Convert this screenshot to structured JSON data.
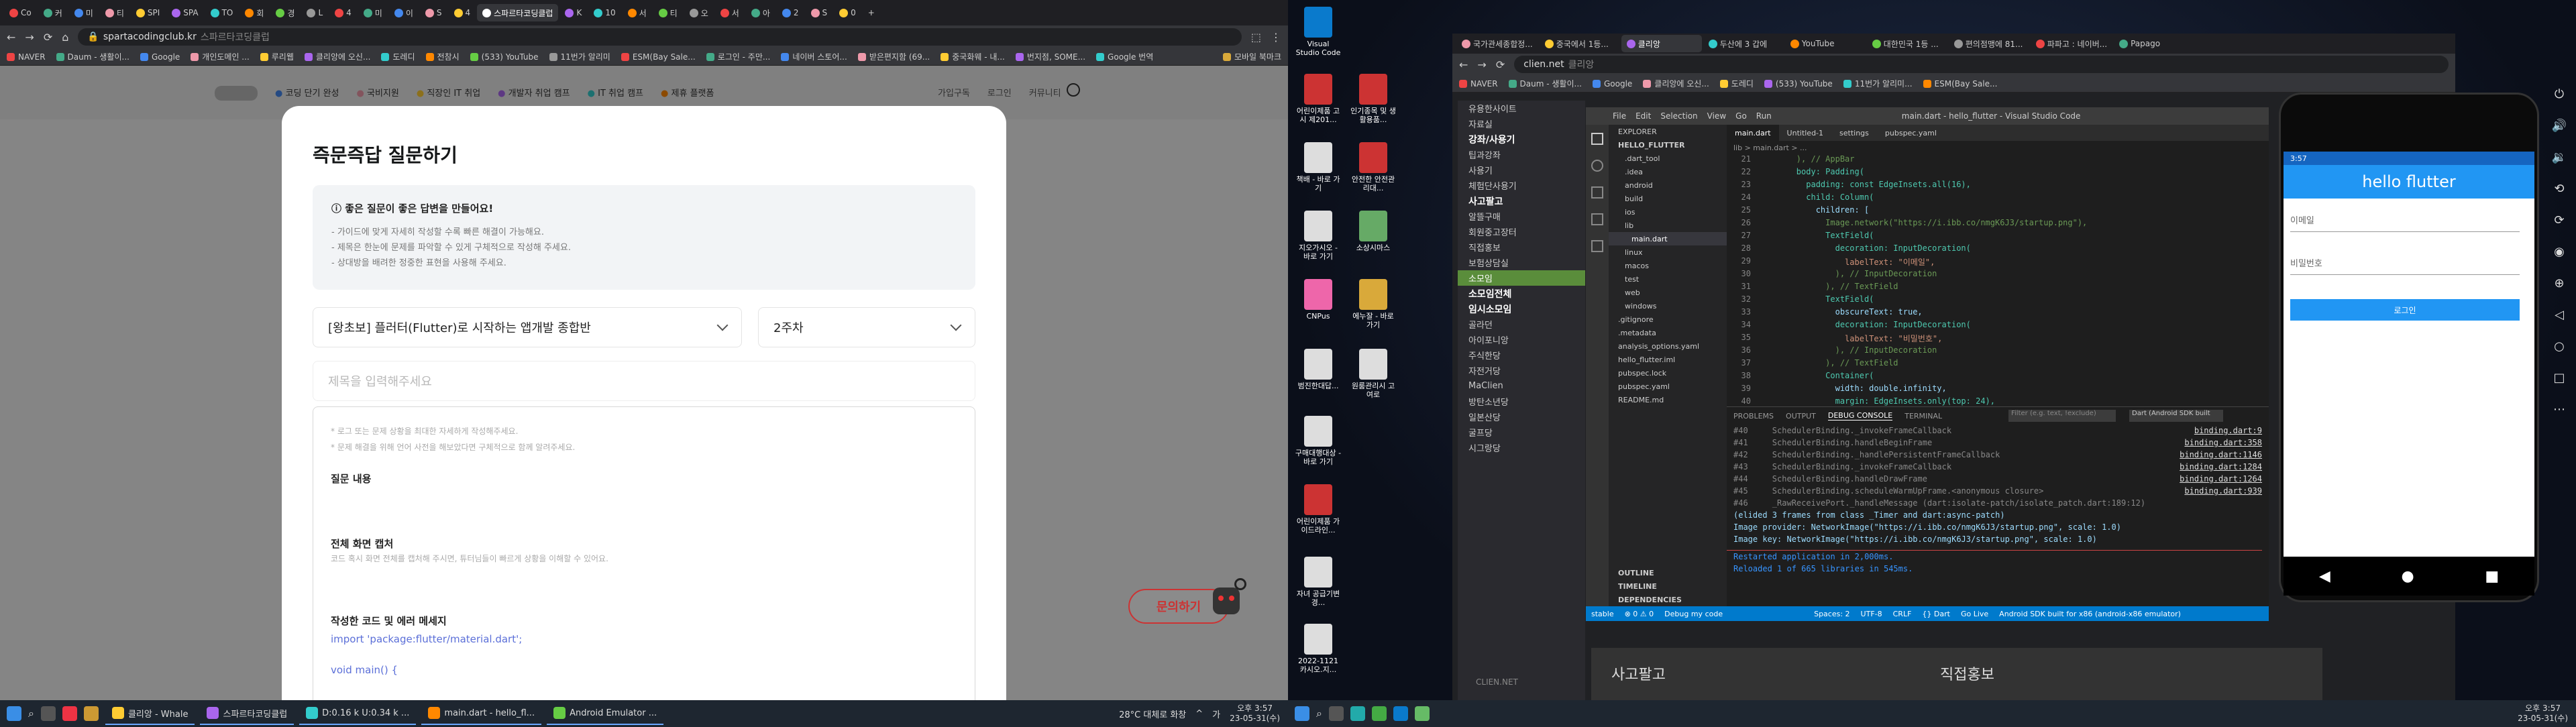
{
  "left_monitor": {
    "browser": {
      "tabs": [
        "Co",
        "커",
        "미",
        "티",
        "SPI",
        "SPA",
        "TO",
        "회",
        "경",
        "L",
        "4",
        "미",
        "이",
        "S",
        "4",
        "K",
        "10",
        "서",
        "티",
        "오",
        "서",
        "아",
        "2",
        "S",
        "0"
      ],
      "active_tab": "스파르타코딩클럽",
      "url": "spartacodingclub.kr",
      "url_hint": "스파르타코딩클럽",
      "bookmarks": [
        "NAVER",
        "Daum - 생활이...",
        "Google",
        "개인도메인 ...",
        "루리웹",
        "클리앙에 오신...",
        "도레디",
        "전참시",
        "(533) YouTube",
        "11번가 알리미",
        "ESM(Bay Sale...",
        "로그인 - 주만...",
        "네이버 스토어...",
        "받은편지함 (69...",
        "중국화웨 - 내...",
        "번지점, SOME...",
        "Google 번역"
      ],
      "bookmark_folder": "모바일 북마크"
    },
    "site_nav": [
      "코딩 단기 완성",
      "국비지원",
      "직장인 IT 취업",
      "개발자 취업 캠프",
      "IT 취업 캠프",
      "제휴 플랫폼"
    ],
    "site_nav_right": [
      "가입구독",
      "로그인",
      "커뮤니티"
    ],
    "modal": {
      "title": "즉문즉답 질문하기",
      "tip_title": "좋은 질문이 좋은 답변을 만들어요!",
      "tip_lines": [
        "- 가이드에 맞게 자세히 작성할 수록 빠른 해결이 가능해요.",
        "- 제목은 한눈에 문제를 파악할 수 있게 구체적으로 작성해 주세요.",
        "- 상대방을 배려한 정중한 표현을 사용해 주세요."
      ],
      "course_select": "[왕초보] 플러터(Flutter)로 시작하는 앱개발 종합반",
      "week_select": "2주차",
      "title_placeholder": "제목을 입력해주세요",
      "editor_hint1": "* 로그 또는 문제 상황을 최대한 자세하게 작성해주세요.",
      "editor_hint2": "* 문제 해결을 위해 언어 사전을 해보았다면 구체적으로 함께 알려주세요.",
      "sec_question": "질문 내용",
      "sec_capture": "전체 화면 캡처",
      "sec_capture_hint": "코드 혹시 화면 전체를 캡처해 주시면, 튜터님들이 빠르게 상황을 이해할 수 있어요.",
      "sec_code": "작성한 코드 및 에러 메세지",
      "code_line1": "import 'package:flutter/material.dart';",
      "code_line2": "void main() {"
    },
    "ask_button": "문의하기",
    "taskbar": {
      "apps": [
        "클리앙 - Whale",
        "스파르타코딩클럽",
        "D:0.16 k U:0.34 k ...",
        "main.dart - hello_fl...",
        "Android Emulator ..."
      ],
      "weather": "28°C 대체로 화창",
      "lang": "가",
      "time": "오후 3:57",
      "date": "23-05-31(수)"
    }
  },
  "right_monitor": {
    "desktop_icons": [
      "Visual Studio Code",
      "어린이제품 고시 제201...",
      "인기종목 및 생활용품...",
      "책배 - 바로 가기",
      "안전한 안전관리대...",
      "지오가시오 - 바로 가기",
      "소상시마스",
      "CNPus",
      "에누잘 - 바로 가기",
      "범진한대답...",
      "원룸관리시 고여로",
      "구매대행대상 - 바로 가기",
      "어린이제품 가이드라인...",
      "자녀 공급기변경...",
      "2022-1121 카시오.지..."
    ],
    "clien": {
      "tabs": [
        "국가관세종합정...",
        "중국에서 1등...",
        "클리앙",
        "두산에 3 갑에",
        "YouTube",
        "대한민국 1등 ...",
        "편의점맹에 81...",
        "파파고 : 네이버...",
        "Papago"
      ],
      "active_tab": "클리앙",
      "url": "clien.net",
      "url_hint": "클리앙",
      "bookmarks": [
        "NAVER",
        "Daum - 생활이...",
        "Google",
        "클리앙에 오신...",
        "도레디",
        "(533) YouTube",
        "11번가 알리미...",
        "ESM(Bay Sale..."
      ],
      "sidebar": [
        "유용한사이트",
        "자료실",
        "강좌/사용기",
        "팁과강좌",
        "사용기",
        "체험단사용기",
        "사고팔고",
        "알뜰구매",
        "회원중고장터",
        "직접홍보",
        "보험상담실",
        "소모임",
        "소모임전체",
        "임시소모임",
        "골라던",
        "아이포니앙",
        "주식한당",
        "자전거당",
        "MaClien",
        "방탄소년당",
        "일본산당",
        "굴프당",
        "시그랑당"
      ],
      "sidebar_active": "소모임",
      "footer": [
        "사고팔고",
        "직접홍보"
      ],
      "footer_logo": "CLIEN.NET"
    },
    "vscode": {
      "title": "main.dart - hello_flutter - Visual Studio Code",
      "menu": [
        "File",
        "Edit",
        "Selection",
        "View",
        "Go",
        "Run"
      ],
      "explorer_title": "EXPLORER",
      "project": "HELLO_FLUTTER",
      "files": [
        ".dart_tool",
        ".idea",
        "android",
        "build",
        "ios",
        "lib",
        "main.dart",
        "linux",
        "macos",
        "test",
        "web",
        "windows",
        ".gitignore",
        ".metadata",
        "analysis_options.yaml",
        "hello_flutter.iml",
        "pubspec.lock",
        "pubspec.yaml",
        "README.md"
      ],
      "selected_file": "main.dart",
      "outline": [
        "OUTLINE",
        "TIMELINE",
        "DEPENDENCIES"
      ],
      "editor_tabs": [
        "main.dart",
        "Untitled-1",
        "settings",
        "pubspec.yaml"
      ],
      "breadcrumb": "lib > main.dart > ...",
      "code": [
        {
          "n": "21",
          "t": "        ), // AppBar"
        },
        {
          "n": "22",
          "t": "        body: Padding("
        },
        {
          "n": "23",
          "t": "          padding: const EdgeInsets.all(16),"
        },
        {
          "n": "24",
          "t": "          child: Column("
        },
        {
          "n": "25",
          "t": "            children: ["
        },
        {
          "n": "26",
          "t": "              Image.network(\"https://i.ibb.co/nmgK6J3/startup.png\"),"
        },
        {
          "n": "27",
          "t": "              TextField("
        },
        {
          "n": "28",
          "t": "                decoration: InputDecoration("
        },
        {
          "n": "29",
          "t": "                  labelText: \"이메일\","
        },
        {
          "n": "30",
          "t": "                ), // InputDecoration"
        },
        {
          "n": "31",
          "t": "              ), // TextField"
        },
        {
          "n": "32",
          "t": "              TextField("
        },
        {
          "n": "33",
          "t": "                obscureText: true,"
        },
        {
          "n": "34",
          "t": "                decoration: InputDecoration("
        },
        {
          "n": "35",
          "t": "                  labelText: \"비밀번호\","
        },
        {
          "n": "36",
          "t": "                ), // InputDecoration"
        },
        {
          "n": "37",
          "t": "              ), // TextField"
        },
        {
          "n": "38",
          "t": "              Container("
        },
        {
          "n": "39",
          "t": "                width: double.infinity,"
        },
        {
          "n": "40",
          "t": "                margin: EdgeInsets.only(top: 24),"
        }
      ],
      "panel_tabs": [
        "PROBLEMS",
        "OUTPUT",
        "DEBUG CONSOLE",
        "TERMINAL"
      ],
      "active_panel": "DEBUG CONSOLE",
      "filter_placeholder": "Filter (e.g. text, !exclude)",
      "device": "Dart (Android SDK built",
      "console": [
        {
          "t": "#40     SchedulerBinding._invokeFrameCallback",
          "r": "binding.dart:9"
        },
        {
          "t": "#41     SchedulerBinding.handleBeginFrame",
          "r": "binding.dart:358"
        },
        {
          "t": "#42     SchedulerBinding._handlePersistentFrameCallback",
          "r": "binding.dart:1146"
        },
        {
          "t": "#43     SchedulerBinding._invokeFrameCallback",
          "r": "binding.dart:1284"
        },
        {
          "t": "#44     SchedulerBinding.handleDrawFrame",
          "r": "binding.dart:1264"
        },
        {
          "t": "#45     SchedulerBinding.scheduleWarmUpFrame.<anonymous closure>",
          "r": "binding.dart:939"
        },
        {
          "t": "#46     _RawReceivePort._handleMessage (dart:isolate-patch/isolate_patch.dart:189:12)",
          "r": ""
        },
        {
          "t": "(elided 3 frames from class _Timer and dart:async-patch)",
          "r": ""
        },
        {
          "t": "Image provider: NetworkImage(\"https://i.ibb.co/nmgK6J3/startup.png\", scale: 1.0)",
          "r": ""
        },
        {
          "t": "Image key: NetworkImage(\"https://i.ibb.co/nmgK6J3/startup.png\", scale: 1.0)",
          "r": ""
        },
        {
          "t": "",
          "r": ""
        },
        {
          "t": "Restarted application in 2,000ms.",
          "r": ""
        },
        {
          "t": "Reloaded 1 of 665 libraries in 545ms.",
          "r": ""
        }
      ],
      "status": [
        "stable",
        "⊗ 0 ⚠ 0",
        "Debug my code",
        "Spaces: 2",
        "UTF-8",
        "CRLF",
        "{} Dart",
        "Go Live",
        "Android SDK built for x86 (android-x86 emulator)"
      ]
    },
    "emulator": {
      "time": "3:57",
      "app_title": "hello flutter",
      "email_label": "이메일",
      "password_label": "비밀번호",
      "login_button": "로그인"
    },
    "taskbar": {
      "time": "오후 3:57",
      "date": "23-05-31(수)"
    }
  }
}
